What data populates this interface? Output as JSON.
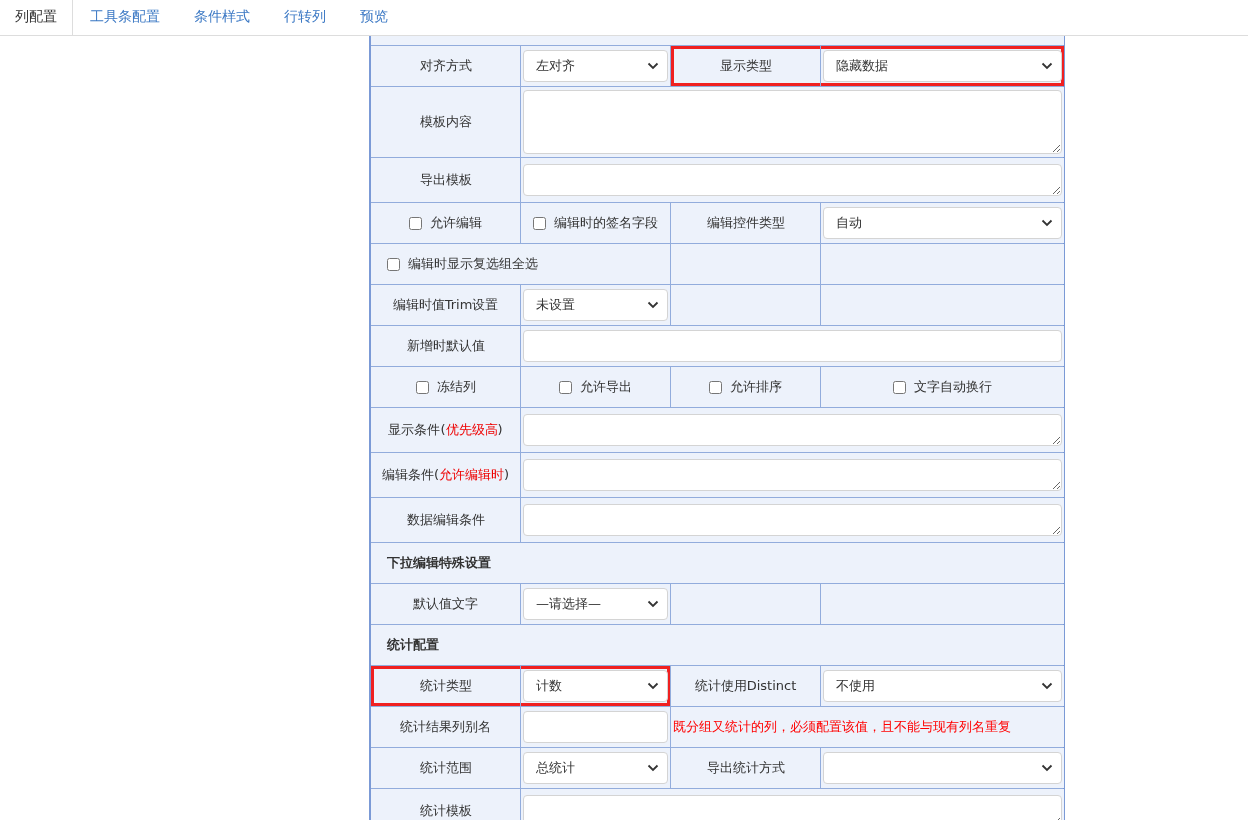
{
  "tabs": [
    {
      "label": "列配置",
      "selected": true
    },
    {
      "label": "工具条配置",
      "selected": false
    },
    {
      "label": "条件样式",
      "selected": false
    },
    {
      "label": "行转列",
      "selected": false
    },
    {
      "label": "预览",
      "selected": false
    }
  ],
  "form": {
    "rows": [
      {
        "cells": [
          {
            "kind": "spacer",
            "highlighted": false
          }
        ]
      },
      {
        "cells": [
          {
            "kind": "label",
            "text": "对齐方式",
            "highlighted": false
          },
          {
            "kind": "select",
            "value": "左对齐",
            "highlighted": false
          },
          {
            "kind": "label",
            "text": "显示类型",
            "highlighted": true
          },
          {
            "kind": "select",
            "value": "隐藏数据",
            "highlighted": true
          }
        ]
      },
      {
        "cells": [
          {
            "kind": "label",
            "text": "模板内容",
            "highlighted": false
          },
          {
            "kind": "tall-textarea",
            "highlighted": false
          }
        ]
      },
      {
        "cells": [
          {
            "kind": "label",
            "text": "导出模板",
            "highlighted": false
          },
          {
            "kind": "wide-textarea",
            "highlighted": false
          }
        ]
      },
      {
        "cells": [
          {
            "kind": "checkbox",
            "text": "允许编辑",
            "checked": false,
            "highlighted": false
          },
          {
            "kind": "checkbox",
            "text": "编辑时的签名字段",
            "checked": false,
            "highlighted": false
          },
          {
            "kind": "label",
            "text": "编辑控件类型",
            "highlighted": false
          },
          {
            "kind": "select",
            "value": "自动",
            "highlighted": false
          }
        ]
      },
      {
        "cells": [
          {
            "kind": "wide-checkbox",
            "text": "编辑时显示复选组全选",
            "checked": false,
            "highlighted": false
          },
          {
            "kind": "empty",
            "highlighted": false
          },
          {
            "kind": "empty",
            "highlighted": false
          }
        ]
      },
      {
        "cells": [
          {
            "kind": "label",
            "text": "编辑时值Trim设置",
            "highlighted": false
          },
          {
            "kind": "select",
            "value": "未设置",
            "highlighted": false
          },
          {
            "kind": "empty",
            "highlighted": false
          },
          {
            "kind": "empty",
            "highlighted": false
          }
        ]
      },
      {
        "cells": [
          {
            "kind": "label",
            "text": "新增时默认值",
            "highlighted": false
          },
          {
            "kind": "wide-input",
            "highlighted": false
          }
        ]
      },
      {
        "cells": [
          {
            "kind": "checkbox",
            "text": "冻结列",
            "checked": false,
            "highlighted": false
          },
          {
            "kind": "checkbox",
            "text": "允许导出",
            "checked": false,
            "highlighted": false
          },
          {
            "kind": "checkbox",
            "text": "允许排序",
            "checked": false,
            "highlighted": false
          },
          {
            "kind": "checkbox",
            "text": "文字自动换行",
            "checked": false,
            "highlighted": false
          }
        ]
      },
      {
        "cells": [
          {
            "kind": "label",
            "text": "显示条件(",
            "accent": "优先级高",
            "tail": ")",
            "highlighted": false
          },
          {
            "kind": "wide-textarea",
            "highlighted": false
          }
        ]
      },
      {
        "cells": [
          {
            "kind": "label",
            "text": "编辑条件(",
            "accent": "允许编辑时",
            "tail": ")",
            "highlighted": false
          },
          {
            "kind": "wide-textarea",
            "highlighted": false
          }
        ]
      },
      {
        "cells": [
          {
            "kind": "label",
            "text": "数据编辑条件",
            "highlighted": false
          },
          {
            "kind": "wide-textarea",
            "highlighted": false
          }
        ]
      },
      {
        "cells": [
          {
            "kind": "banner",
            "text": "下拉编辑特殊设置",
            "highlighted": false
          }
        ]
      },
      {
        "cells": [
          {
            "kind": "label",
            "text": "默认值文字",
            "highlighted": false
          },
          {
            "kind": "select",
            "value": "—请选择—",
            "highlighted": false
          },
          {
            "kind": "empty",
            "highlighted": false
          },
          {
            "kind": "empty",
            "highlighted": false
          }
        ]
      },
      {
        "cells": [
          {
            "kind": "banner",
            "text": "统计配置",
            "highlighted": false
          }
        ]
      },
      {
        "cells": [
          {
            "kind": "label",
            "text": "统计类型",
            "highlighted": true
          },
          {
            "kind": "select",
            "value": "计数",
            "highlighted": true
          },
          {
            "kind": "label",
            "text": "统计使用Distinct",
            "highlighted": false
          },
          {
            "kind": "select",
            "value": "不使用",
            "highlighted": false
          }
        ]
      },
      {
        "cells": [
          {
            "kind": "label",
            "text": "统计结果列别名",
            "highlighted": false
          },
          {
            "kind": "input",
            "highlighted": false
          },
          {
            "kind": "note",
            "text": "既分组又统计的列，必须配置该值，且不能与现有列名重复",
            "highlighted": false
          }
        ]
      },
      {
        "cells": [
          {
            "kind": "label",
            "text": "统计范围",
            "highlighted": false
          },
          {
            "kind": "select",
            "value": "总统计",
            "highlighted": false
          },
          {
            "kind": "label",
            "text": "导出统计方式",
            "highlighted": false
          },
          {
            "kind": "select",
            "highlighted": false
          }
        ]
      },
      {
        "cells": [
          {
            "kind": "label",
            "text": "统计模板",
            "highlighted": false
          },
          {
            "kind": "wide-textarea",
            "highlighted": false
          }
        ]
      }
    ]
  }
}
